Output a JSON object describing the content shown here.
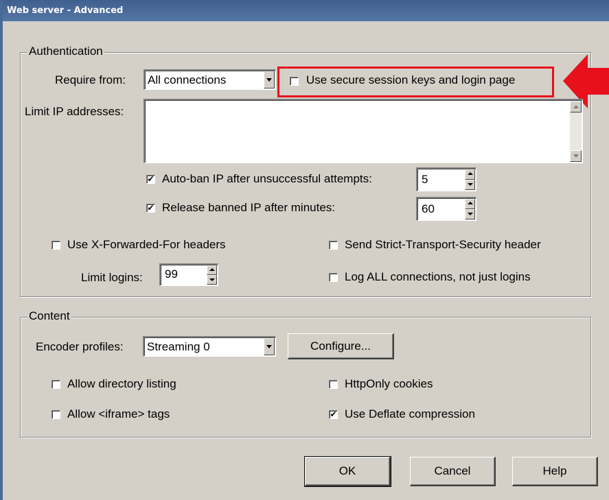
{
  "window": {
    "title": "Web server - Advanced"
  },
  "authentication": {
    "legend": "Authentication",
    "require_from_label": "Require from:",
    "require_from_value": "All connections",
    "secure_session": {
      "label": "Use secure session keys and login page",
      "checked": false
    },
    "limit_ip_label": "Limit IP addresses:",
    "limit_ip_value": "",
    "auto_ban": {
      "label": "Auto-ban IP after unsuccessful attempts:",
      "checked": true,
      "value": "5"
    },
    "release_ban": {
      "label": "Release banned IP after minutes:",
      "checked": true,
      "value": "60"
    },
    "x_forwarded": {
      "label": "Use X-Forwarded-For headers",
      "checked": false
    },
    "strict_transport": {
      "label": "Send Strict-Transport-Security header",
      "checked": false
    },
    "limit_logins_label": "Limit logins:",
    "limit_logins_value": "99",
    "log_all": {
      "label": "Log ALL connections, not just logins",
      "checked": false
    }
  },
  "content": {
    "legend": "Content",
    "encoder_label": "Encoder profiles:",
    "encoder_value": "Streaming 0",
    "configure_button": "Configure...",
    "dir_listing": {
      "label": "Allow directory listing",
      "checked": false
    },
    "httponly": {
      "label": "HttpOnly cookies",
      "checked": false
    },
    "iframe": {
      "label": "Allow <iframe> tags",
      "checked": false
    },
    "deflate": {
      "label": "Use Deflate compression",
      "checked": true
    }
  },
  "buttons": {
    "ok": "OK",
    "cancel": "Cancel",
    "help": "Help"
  },
  "annotation": {
    "highlight_color": "#e8101a",
    "arrow_color": "#e8101a"
  },
  "icons": {
    "check": "✔",
    "arrow": "red-arrow-left-icon"
  }
}
